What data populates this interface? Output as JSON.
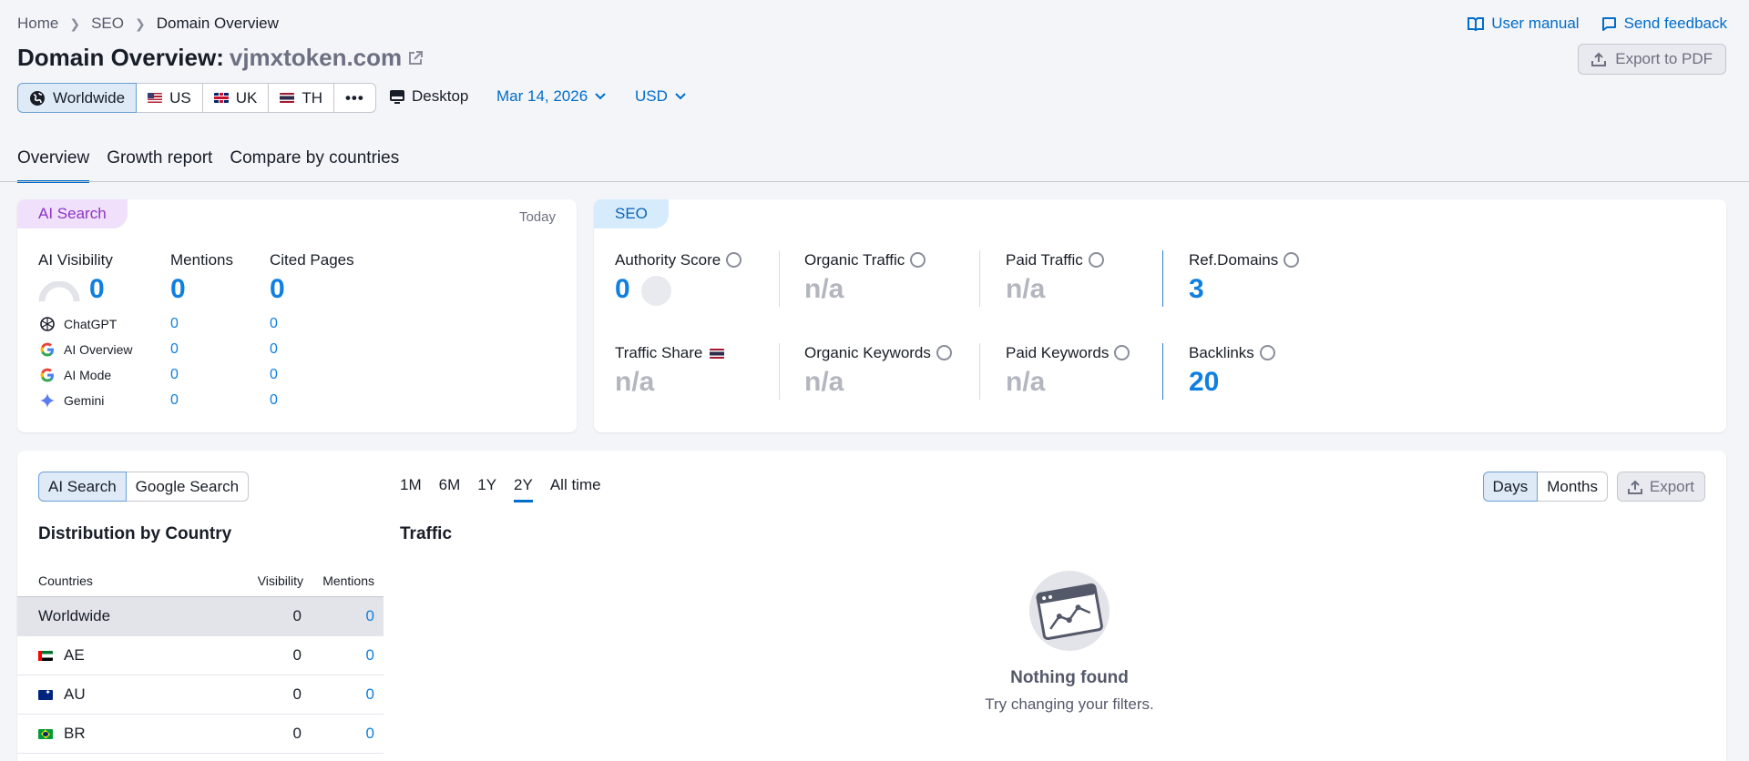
{
  "breadcrumb": {
    "home": "Home",
    "seo": "SEO",
    "current": "Domain Overview"
  },
  "top_links": {
    "manual": "User manual",
    "feedback": "Send feedback"
  },
  "title": {
    "prefix": "Domain Overview:",
    "domain": "vjmxtoken.com"
  },
  "export_pdf": "Export to PDF",
  "regions": [
    {
      "label": "Worldwide",
      "flag": "globe"
    },
    {
      "label": "US",
      "flag": "us"
    },
    {
      "label": "UK",
      "flag": "uk"
    },
    {
      "label": "TH",
      "flag": "th"
    }
  ],
  "device": "Desktop",
  "date": "Mar 14, 2026",
  "currency": "USD",
  "tabs": [
    "Overview",
    "Growth report",
    "Compare by countries"
  ],
  "ai_card": {
    "tag": "AI Search",
    "today": "Today",
    "visibility_label": "AI Visibility",
    "visibility_value": "0",
    "mentions_label": "Mentions",
    "mentions_value": "0",
    "cited_label": "Cited Pages",
    "cited_value": "0",
    "rows": [
      {
        "name": "ChatGPT",
        "mentions": "0",
        "cited": "0",
        "icon": "chatgpt-icon"
      },
      {
        "name": "AI Overview",
        "mentions": "0",
        "cited": "0",
        "icon": "google-icon"
      },
      {
        "name": "AI Mode",
        "mentions": "0",
        "cited": "0",
        "icon": "google-icon"
      },
      {
        "name": "Gemini",
        "mentions": "0",
        "cited": "0",
        "icon": "gemini-icon"
      }
    ]
  },
  "seo_card": {
    "tag": "SEO",
    "authority_label": "Authority Score",
    "authority_value": "0",
    "organic_traffic_label": "Organic Traffic",
    "organic_traffic_value": "n/a",
    "paid_traffic_label": "Paid Traffic",
    "paid_traffic_value": "n/a",
    "ref_domains_label": "Ref.Domains",
    "ref_domains_value": "3",
    "traffic_share_label": "Traffic Share",
    "traffic_share_value": "n/a",
    "organic_keywords_label": "Organic Keywords",
    "organic_keywords_value": "n/a",
    "paid_keywords_label": "Paid Keywords",
    "paid_keywords_value": "n/a",
    "backlinks_label": "Backlinks",
    "backlinks_value": "20"
  },
  "bottom": {
    "source_tabs": [
      "AI Search",
      "Google Search"
    ],
    "periods": [
      "1M",
      "6M",
      "1Y",
      "2Y",
      "All time"
    ],
    "granularity": [
      "Days",
      "Months"
    ],
    "export": "Export",
    "dist_title": "Distribution by Country",
    "traffic_title": "Traffic",
    "table": {
      "headers": {
        "countries": "Countries",
        "visibility": "Visibility",
        "mentions": "Mentions"
      },
      "rows": [
        {
          "country": "Worldwide",
          "visibility": "0",
          "mentions": "0",
          "flag": ""
        },
        {
          "country": "AE",
          "visibility": "0",
          "mentions": "0",
          "flag": "ae"
        },
        {
          "country": "AU",
          "visibility": "0",
          "mentions": "0",
          "flag": "au"
        },
        {
          "country": "BR",
          "visibility": "0",
          "mentions": "0",
          "flag": "br"
        }
      ]
    },
    "empty_title": "Nothing found",
    "empty_sub": "Try changing your filters."
  },
  "colors": {
    "accent": "#006dca",
    "value_blue": "#0f7fe0",
    "muted": "#b3b6bf"
  }
}
